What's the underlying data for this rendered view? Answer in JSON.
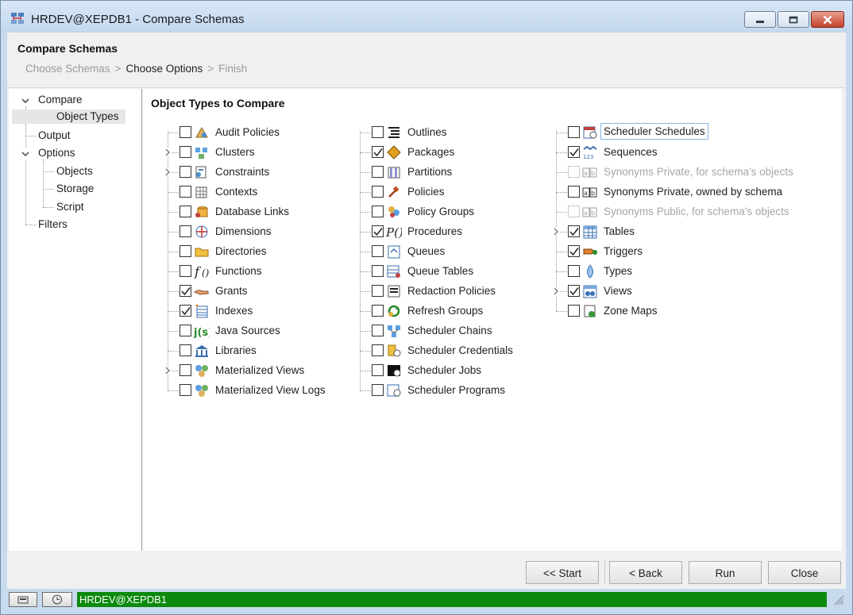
{
  "window": {
    "title": "HRDEV@XEPDB1 - Compare Schemas"
  },
  "wizard": {
    "title": "Compare Schemas",
    "breadcrumbs": [
      {
        "label": "Choose Schemas",
        "active": false
      },
      {
        "label": "Choose Options",
        "active": true
      },
      {
        "label": "Finish",
        "active": false
      }
    ],
    "separator": ">"
  },
  "nav": {
    "compare": "Compare",
    "object_types": "Object Types",
    "output": "Output",
    "options": "Options",
    "objects": "Objects",
    "storage": "Storage",
    "script": "Script",
    "filters": "Filters"
  },
  "section_title": "Object Types to Compare",
  "columns": [
    [
      {
        "label": "Audit Policies",
        "checked": false,
        "icon": "audit-policies-icon"
      },
      {
        "label": "Clusters",
        "checked": false,
        "icon": "clusters-icon",
        "expandable": true
      },
      {
        "label": "Constraints",
        "checked": false,
        "icon": "constraints-icon",
        "expandable": true
      },
      {
        "label": "Contexts",
        "checked": false,
        "icon": "contexts-icon"
      },
      {
        "label": "Database Links",
        "checked": false,
        "icon": "database-links-icon"
      },
      {
        "label": "Dimensions",
        "checked": false,
        "icon": "dimensions-icon"
      },
      {
        "label": "Directories",
        "checked": false,
        "icon": "directories-icon"
      },
      {
        "label": "Functions",
        "checked": false,
        "icon": "functions-icon"
      },
      {
        "label": "Grants",
        "checked": true,
        "icon": "grants-icon"
      },
      {
        "label": "Indexes",
        "checked": true,
        "icon": "indexes-icon"
      },
      {
        "label": "Java Sources",
        "checked": false,
        "icon": "java-sources-icon"
      },
      {
        "label": "Libraries",
        "checked": false,
        "icon": "libraries-icon"
      },
      {
        "label": "Materialized Views",
        "checked": false,
        "icon": "materialized-views-icon",
        "expandable": true
      },
      {
        "label": "Materialized View Logs",
        "checked": false,
        "icon": "materialized-view-logs-icon"
      }
    ],
    [
      {
        "label": "Outlines",
        "checked": false,
        "icon": "outlines-icon"
      },
      {
        "label": "Packages",
        "checked": true,
        "icon": "packages-icon"
      },
      {
        "label": "Partitions",
        "checked": false,
        "icon": "partitions-icon"
      },
      {
        "label": "Policies",
        "checked": false,
        "icon": "policies-icon"
      },
      {
        "label": "Policy Groups",
        "checked": false,
        "icon": "policy-groups-icon"
      },
      {
        "label": "Procedures",
        "checked": true,
        "icon": "procedures-icon"
      },
      {
        "label": "Queues",
        "checked": false,
        "icon": "queues-icon"
      },
      {
        "label": "Queue Tables",
        "checked": false,
        "icon": "queue-tables-icon"
      },
      {
        "label": "Redaction Policies",
        "checked": false,
        "icon": "redaction-policies-icon"
      },
      {
        "label": "Refresh Groups",
        "checked": false,
        "icon": "refresh-groups-icon"
      },
      {
        "label": "Scheduler Chains",
        "checked": false,
        "icon": "scheduler-chains-icon"
      },
      {
        "label": "Scheduler Credentials",
        "checked": false,
        "icon": "scheduler-credentials-icon"
      },
      {
        "label": "Scheduler Jobs",
        "checked": false,
        "icon": "scheduler-jobs-icon"
      },
      {
        "label": "Scheduler Programs",
        "checked": false,
        "icon": "scheduler-programs-icon"
      }
    ],
    [
      {
        "label": "Scheduler Schedules",
        "checked": false,
        "icon": "scheduler-schedules-icon",
        "focused": true
      },
      {
        "label": "Sequences",
        "checked": true,
        "icon": "sequences-icon"
      },
      {
        "label": "Synonyms Private, for schema's objects",
        "checked": false,
        "icon": "synonyms-icon",
        "disabled": true
      },
      {
        "label": "Synonyms Private, owned by schema",
        "checked": false,
        "icon": "synonyms-icon"
      },
      {
        "label": "Synonyms Public, for schema's objects",
        "checked": false,
        "icon": "synonyms-icon",
        "disabled": true
      },
      {
        "label": "Tables",
        "checked": true,
        "icon": "tables-icon",
        "expandable": true
      },
      {
        "label": "Triggers",
        "checked": true,
        "icon": "triggers-icon"
      },
      {
        "label": "Types",
        "checked": false,
        "icon": "types-icon"
      },
      {
        "label": "Views",
        "checked": true,
        "icon": "views-icon",
        "expandable": true
      },
      {
        "label": "Zone Maps",
        "checked": false,
        "icon": "zone-maps-icon"
      }
    ]
  ],
  "buttons": {
    "start": "<< Start",
    "back": "< Back",
    "run": "Run",
    "close": "Close"
  },
  "status": {
    "connection": "HRDEV@XEPDB1"
  },
  "colors": {
    "status_green": "#0d8a0d",
    "title_bar": "#c8daee",
    "close_red": "#c4402a"
  }
}
